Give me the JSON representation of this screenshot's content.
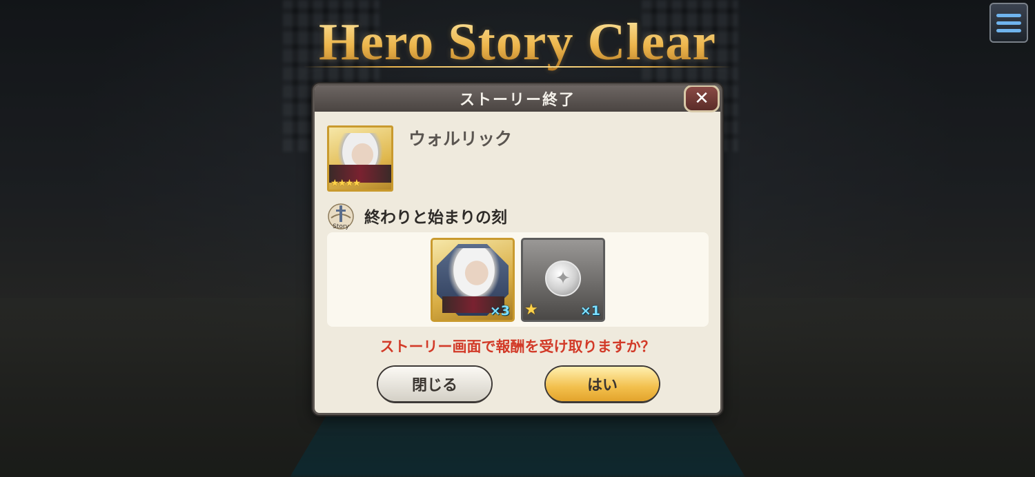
{
  "banner": {
    "title": "Hero Story Clear"
  },
  "dialog": {
    "header": "ストーリー終了",
    "close_icon": "✕",
    "hero": {
      "name": "ウォルリック",
      "stars": "★★★★",
      "rarity": 4
    },
    "story": {
      "icon_label": "Story",
      "title": "終わりと始まりの刻"
    },
    "rewards": [
      {
        "icon": "hero-portrait-icon",
        "quantity": "×3"
      },
      {
        "icon": "silver-coin-icon",
        "rank_star": "★",
        "quantity": "×1"
      }
    ],
    "prompt": "ストーリー画面で報酬を受け取りますか？",
    "buttons": {
      "close": "閉じる",
      "yes": "はい"
    }
  },
  "menu": {
    "icon": "hamburger-menu-icon"
  },
  "colors": {
    "prompt": "#d23a28",
    "title_gold": "#e8b24a",
    "qty": "#7ee0ff"
  }
}
